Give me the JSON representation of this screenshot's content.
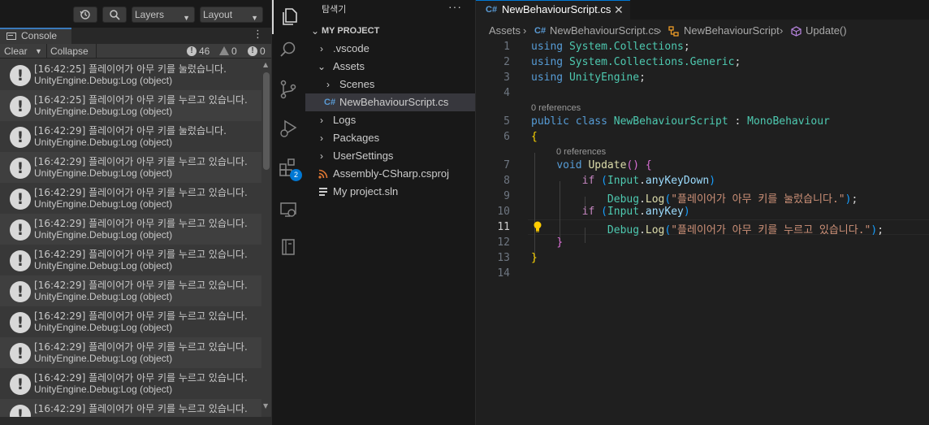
{
  "unity": {
    "topbar": {
      "layers_label": "Layers",
      "layout_label": "Layout"
    },
    "tab_label": "Console",
    "toolbar": {
      "clear": "Clear",
      "collapse": "Collapse",
      "info_count": "46",
      "warn_count": "0",
      "error_count": "0"
    },
    "logs": [
      {
        "line1": "[16:42:25] 플레이어가 아무 키를 눌렀습니다.",
        "line2": "UnityEngine.Debug:Log (object)"
      },
      {
        "line1": "[16:42:25] 플레이어가 아무 키를 누르고 있습니다.",
        "line2": "UnityEngine.Debug:Log (object)"
      },
      {
        "line1": "[16:42:29] 플레이어가 아무 키를 눌렀습니다.",
        "line2": "UnityEngine.Debug:Log (object)"
      },
      {
        "line1": "[16:42:29] 플레이어가 아무 키를 누르고 있습니다.",
        "line2": "UnityEngine.Debug:Log (object)"
      },
      {
        "line1": "[16:42:29] 플레이어가 아무 키를 누르고 있습니다.",
        "line2": "UnityEngine.Debug:Log (object)"
      },
      {
        "line1": "[16:42:29] 플레이어가 아무 키를 누르고 있습니다.",
        "line2": "UnityEngine.Debug:Log (object)"
      },
      {
        "line1": "[16:42:29] 플레이어가 아무 키를 누르고 있습니다.",
        "line2": "UnityEngine.Debug:Log (object)"
      },
      {
        "line1": "[16:42:29] 플레이어가 아무 키를 누르고 있습니다.",
        "line2": "UnityEngine.Debug:Log (object)"
      },
      {
        "line1": "[16:42:29] 플레이어가 아무 키를 누르고 있습니다.",
        "line2": "UnityEngine.Debug:Log (object)"
      },
      {
        "line1": "[16:42:29] 플레이어가 아무 키를 누르고 있습니다.",
        "line2": "UnityEngine.Debug:Log (object)"
      },
      {
        "line1": "[16:42:29] 플레이어가 아무 키를 누르고 있습니다.",
        "line2": "UnityEngine.Debug:Log (object)"
      },
      {
        "line1": "[16:42:29] 플레이어가 아무 키를 누르고 있습니다.",
        "line2": ""
      }
    ]
  },
  "activity_bar": {
    "extensions_badge": "2"
  },
  "explorer": {
    "title": "탐색기",
    "more": "···",
    "project": "MY PROJECT",
    "items": [
      {
        "label": ".vscode",
        "chevron": "›",
        "icon": "folder"
      },
      {
        "label": "Assets",
        "chevron": "⌄",
        "icon": "folder"
      },
      {
        "label": "Scenes",
        "chevron": "›",
        "icon": "folder"
      },
      {
        "label": "NewBehaviourScript.cs",
        "chevron": "",
        "icon": "csharp"
      },
      {
        "label": "Logs",
        "chevron": "›",
        "icon": "folder"
      },
      {
        "label": "Packages",
        "chevron": "›",
        "icon": "folder"
      },
      {
        "label": "UserSettings",
        "chevron": "›",
        "icon": "folder"
      },
      {
        "label": "Assembly-CSharp.csproj",
        "chevron": "",
        "icon": "rss"
      },
      {
        "label": "My project.sln",
        "chevron": "",
        "icon": "list"
      }
    ]
  },
  "editor": {
    "tab": {
      "label": "NewBehaviourScript.cs",
      "close": "✕"
    },
    "breadcrumbs": [
      "Assets",
      "NewBehaviourScript.cs",
      "NewBehaviourScript",
      "Update()"
    ],
    "code_lens": [
      "0 references",
      "0 references"
    ],
    "line_numbers": [
      "1",
      "2",
      "3",
      "4",
      "5",
      "6",
      "7",
      "8",
      "9",
      "10",
      "11",
      "12",
      "13",
      "14"
    ],
    "code": {
      "l1_kw": "using",
      "l1_ns": "System.Collections",
      "l2_kw": "using",
      "l2_ns": "System.Collections.Generic",
      "l3_kw": "using",
      "l3_ns": "UnityEngine",
      "l5_kw1": "public",
      "l5_kw2": "class",
      "l5_type": "NewBehaviourScript",
      "l5_base": "MonoBehaviour",
      "l7_kw": "void",
      "l7_fn": "Update",
      "l8_kw": "if",
      "l8_var": "Input",
      "l8_prop": "anyKeyDown",
      "l9_obj": "Debug",
      "l9_fn": "Log",
      "l9_str": "\"플레이어가 아무 키를 눌렀습니다.\"",
      "l10_kw": "if",
      "l10_var": "Input",
      "l10_prop": "anyKey",
      "l11_obj": "Debug",
      "l11_fn": "Log",
      "l11_str": "\"플레이어가 아무 키를 누르고 있습니다.\""
    }
  },
  "colors": {
    "accent": "#0078d4",
    "keyword": "#569cd6",
    "control": "#c586c0",
    "type": "#4ec9b0",
    "function": "#dcdcaa",
    "string": "#ce9178",
    "variable": "#9cdcfe"
  }
}
